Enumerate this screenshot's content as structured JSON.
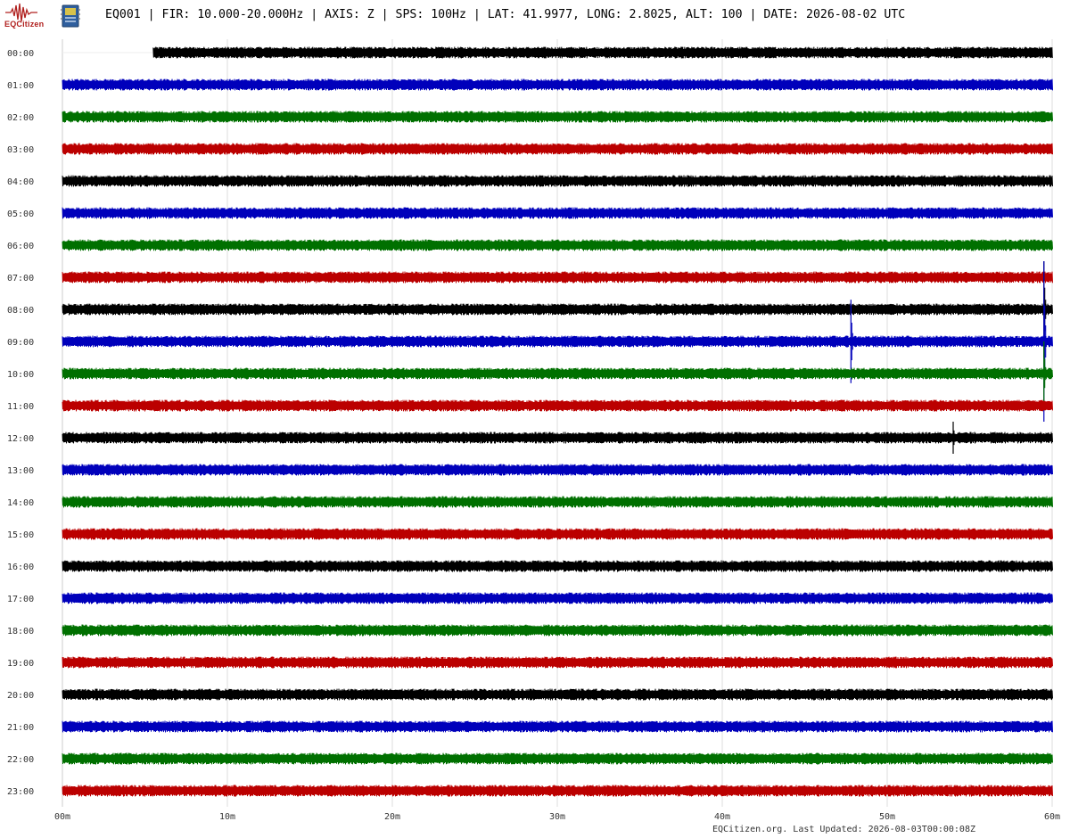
{
  "header": {
    "logo_text": "EQCitizen",
    "title": "EQ001 | FIR: 10.000-20.000Hz | AXIS: Z | SPS: 100Hz | LAT: 41.9977, LONG: 2.8025, ALT: 100 | DATE: 2026-08-02 UTC"
  },
  "footer": {
    "text": "EQCitizen.org. Last Updated: 2026-08-03T00:00:08Z"
  },
  "colors": {
    "trace_cycle": [
      "#000000",
      "#0000bb",
      "#007000",
      "#bb0000"
    ],
    "grid": "#dddddd",
    "label": "#333333"
  },
  "chart_data": {
    "type": "line",
    "title": "EQ001 | FIR: 10.000-20.000Hz | AXIS: Z | SPS: 100Hz | LAT: 41.9977, LONG: 2.8025, ALT: 100 | DATE: 2026-08-02 UTC",
    "xlabel": "",
    "ylabel": "",
    "x_ticks": [
      "00m",
      "10m",
      "20m",
      "30m",
      "40m",
      "50m",
      "60m"
    ],
    "xlim": [
      0,
      60
    ],
    "grid": true,
    "rows": [
      {
        "label": "00:00",
        "start_minute": 5.5
      },
      {
        "label": "01:00"
      },
      {
        "label": "02:00"
      },
      {
        "label": "03:00"
      },
      {
        "label": "04:00"
      },
      {
        "label": "05:00"
      },
      {
        "label": "06:00"
      },
      {
        "label": "07:00"
      },
      {
        "label": "08:00",
        "events": [
          {
            "minute": 59.5,
            "amplitude": 1.5
          }
        ]
      },
      {
        "label": "09:00",
        "events": [
          {
            "minute": 47.8,
            "amplitude": 1.3
          },
          {
            "minute": 59.5,
            "amplitude": 2.5
          }
        ]
      },
      {
        "label": "10:00",
        "events": [
          {
            "minute": 59.5,
            "amplitude": 1.0
          }
        ]
      },
      {
        "label": "11:00"
      },
      {
        "label": "12:00",
        "events": [
          {
            "minute": 54.0,
            "amplitude": 0.5
          }
        ]
      },
      {
        "label": "13:00"
      },
      {
        "label": "14:00"
      },
      {
        "label": "15:00"
      },
      {
        "label": "16:00"
      },
      {
        "label": "17:00"
      },
      {
        "label": "18:00"
      },
      {
        "label": "19:00"
      },
      {
        "label": "20:00"
      },
      {
        "label": "21:00"
      },
      {
        "label": "22:00"
      },
      {
        "label": "23:00"
      }
    ]
  }
}
